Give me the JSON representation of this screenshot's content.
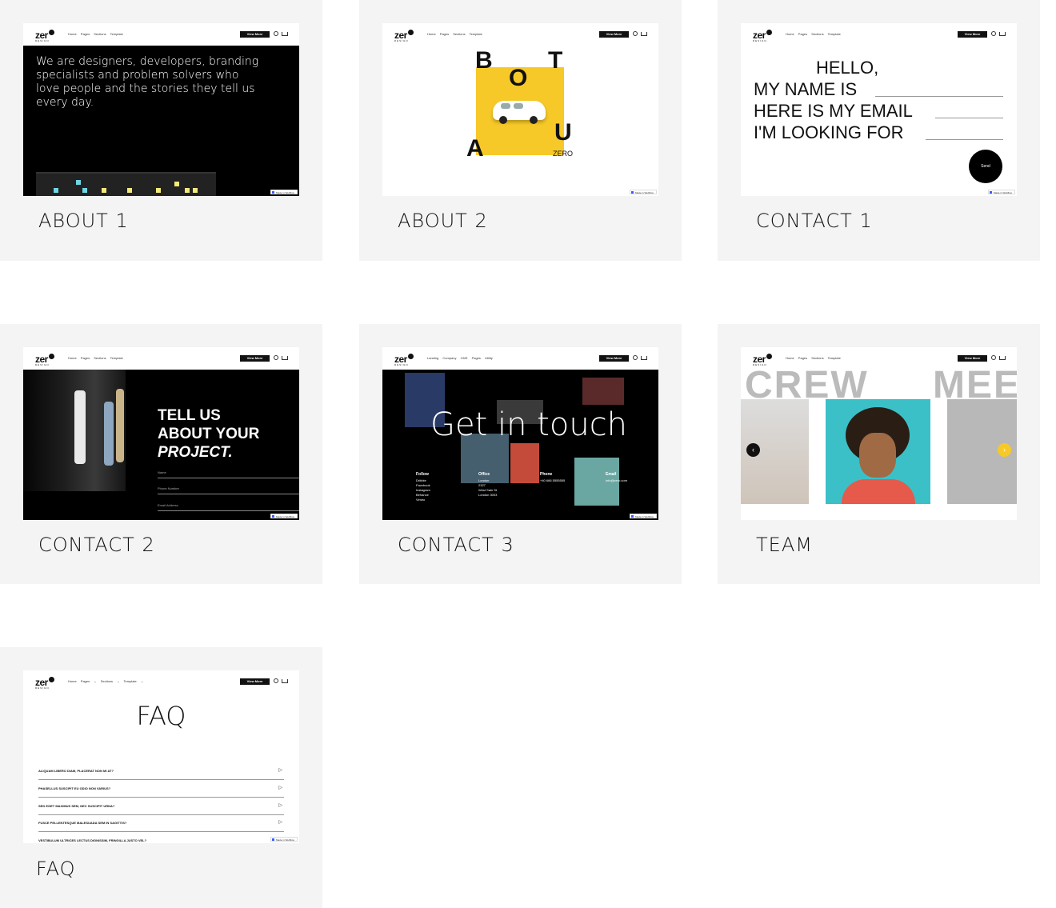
{
  "nav": {
    "logo": "zer",
    "logo_sub": "DESIGN",
    "links": "Home  Pages  Sections  Template",
    "links_faq": "Home  Pages ⌄ Sections ⌄ Template ⌄",
    "links_c3": "Landing  Company  CMS Pages  Utility",
    "button": "View More",
    "badge": "Made in Webflow"
  },
  "cards": {
    "about1": {
      "title": "ABOUT 1",
      "text": "We are designers, developers, branding specialists and problem solvers who love people and the stories they tell us every day."
    },
    "about2": {
      "title": "ABOUT 2",
      "letters": [
        "B",
        "T",
        "O",
        "A",
        "U"
      ],
      "brand": "ZERO"
    },
    "contact1": {
      "title": "CONTACT 1",
      "lines": [
        "HELLO,",
        "MY NAME IS",
        "HERE IS MY EMAIL",
        "I'M LOOKING FOR"
      ],
      "send": "Send"
    },
    "contact2": {
      "title": "CONTACT 2",
      "heading1": "TELL US",
      "heading2": "ABOUT YOUR",
      "heading3": "PROJECT.",
      "fields": [
        "Name",
        "Phone Number",
        "Email Address"
      ]
    },
    "contact3": {
      "title": "CONTACT 3",
      "headline": "Get in touch",
      "follow_label": "Follow",
      "follow": [
        "Dribble",
        "Facebook",
        "Instagram",
        "Behance",
        "Vimeo"
      ],
      "office_label": "Office",
      "office": [
        "London",
        "2327",
        "West Sain St",
        "London 3003"
      ],
      "phone_label": "Phone",
      "phone": "+40 666 5555555",
      "email_label": "Email",
      "email": "info@zero.com"
    },
    "team": {
      "title": "TEAM",
      "crew": "CREW",
      "mee": "MEE",
      "prev": "‹",
      "next": "›"
    },
    "faq": {
      "title": "FAQ",
      "heading": "FAQ",
      "items": [
        "ALIQUAM LIBERO DIAM, PLACERAT NON MI AT?",
        "PHASELLUS SUSCIPIT EU ODIO NON VARIUS?",
        "SED EGET MAXIMUS SEM, NEC SUSCIPIT URNA?",
        "FUSCE PELLENTESQUE MALESUADA SEM IN SAGITTIS?",
        "VESTIBULUM ULTRICES LECTUS DIGNISSIM, FRINGILLA JUSTO VEL?"
      ]
    }
  },
  "colors": {
    "card_bg": "#f4f4f4",
    "yellow": "#f7c928",
    "team_teal": "#3bc0c8"
  }
}
